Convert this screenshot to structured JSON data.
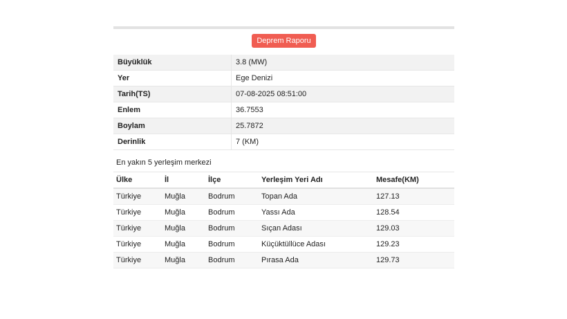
{
  "button": {
    "label": "Deprem Raporu"
  },
  "info": [
    {
      "key": "Büyüklük",
      "value": "3.8 (MW)"
    },
    {
      "key": "Yer",
      "value": "Ege Denizi"
    },
    {
      "key": "Tarih(TS)",
      "value": "07-08-2025 08:51:00"
    },
    {
      "key": "Enlem",
      "value": "36.7553"
    },
    {
      "key": "Boylam",
      "value": "25.7872"
    },
    {
      "key": "Derinlik",
      "value": "7 (KM)"
    }
  ],
  "nearest": {
    "title": "En yakın 5 yerleşim merkezi",
    "headers": [
      "Ülke",
      "İl",
      "İlçe",
      "Yerleşim Yeri Adı",
      "Mesafe(KM)"
    ],
    "rows": [
      [
        "Türkiye",
        "Muğla",
        "Bodrum",
        "Topan Ada",
        "127.13"
      ],
      [
        "Türkiye",
        "Muğla",
        "Bodrum",
        "Yassı Ada",
        "128.54"
      ],
      [
        "Türkiye",
        "Muğla",
        "Bodrum",
        "Sıçan Adası",
        "129.03"
      ],
      [
        "Türkiye",
        "Muğla",
        "Bodrum",
        "Küçüktüllüce Adası",
        "129.23"
      ],
      [
        "Türkiye",
        "Muğla",
        "Bodrum",
        "Pırasa Ada",
        "129.73"
      ]
    ]
  }
}
